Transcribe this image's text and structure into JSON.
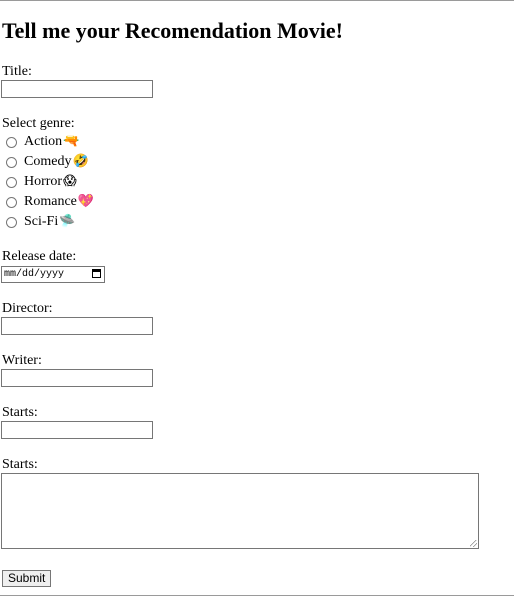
{
  "form": {
    "heading": "Tell me your Recomendation Movie!",
    "title_label": "Title:",
    "title_value": "",
    "genre_label": "Select genre:",
    "genres": [
      {
        "label": "Action",
        "emoji": "🔫"
      },
      {
        "label": "Comedy",
        "emoji": "🤣"
      },
      {
        "label": "Horror",
        "emoji": "😱"
      },
      {
        "label": "Romance",
        "emoji": "💖"
      },
      {
        "label": "Sci-Fi",
        "emoji": "🛸"
      }
    ],
    "release_label": "Release date:",
    "release_placeholder": "mm/dd/yyyy",
    "director_label": "Director:",
    "director_value": "",
    "writer_label": "Writer:",
    "writer_value": "",
    "starts_label": "Starts:",
    "starts_value": "",
    "starts2_label": "Starts:",
    "starts2_value": "",
    "submit_label": "Submit"
  },
  "icons": {
    "date_picker": "calendar-icon",
    "textarea_resize": "resize-grip-icon"
  }
}
